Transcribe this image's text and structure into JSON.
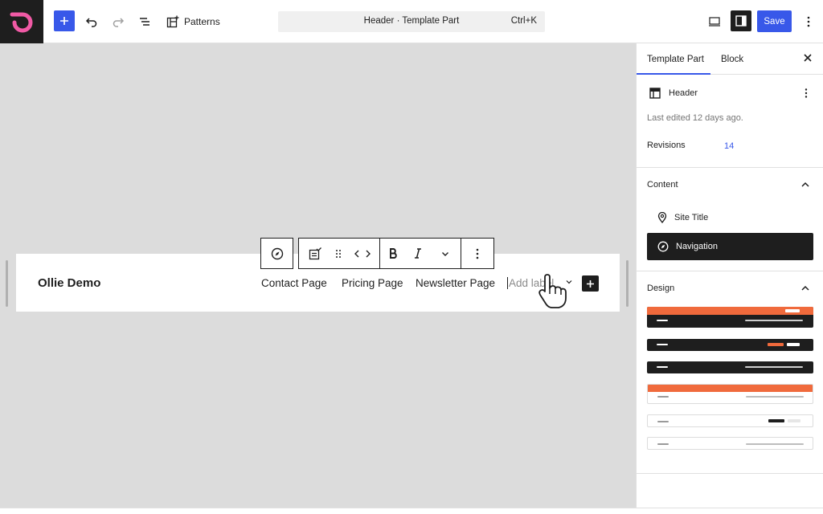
{
  "toolbar": {
    "patterns_label": "Patterns",
    "document_title": "Header · Template Part",
    "shortcut": "Ctrl+K",
    "save_label": "Save"
  },
  "canvas": {
    "site_title": "Ollie Demo",
    "nav_links": [
      "Contact Page",
      "Pricing Page",
      "Newsletter Page"
    ],
    "add_label_placeholder": "Add label"
  },
  "sidebar": {
    "tabs": [
      "Template Part",
      "Block"
    ],
    "template_name": "Header",
    "last_edited": "Last edited 12 days ago.",
    "revisions_label": "Revisions",
    "revisions_count": "14",
    "content_heading": "Content",
    "content_items": [
      "Site Title",
      "Navigation"
    ],
    "design_heading": "Design"
  },
  "colors": {
    "accent": "#3858e9",
    "dark": "#1e1e1e",
    "pattern_orange": "#f06a3c",
    "logo_pink": "#f05aa5"
  }
}
